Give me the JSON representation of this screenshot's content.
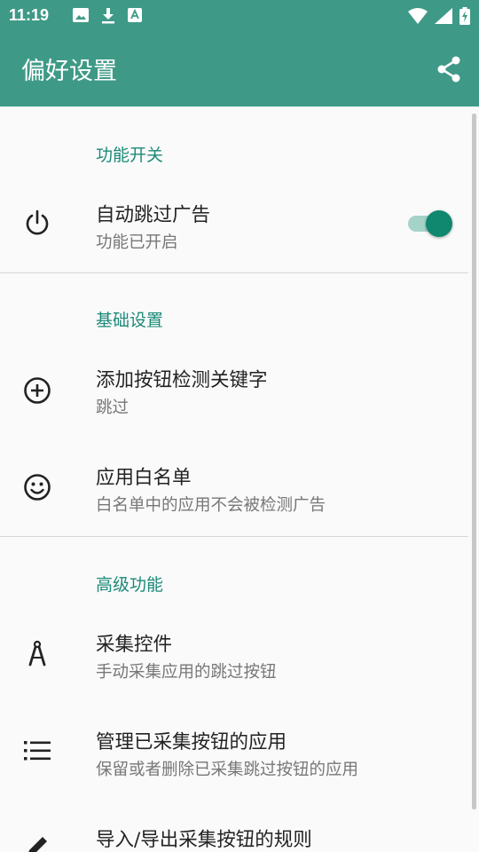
{
  "status_bar": {
    "time": "11:19",
    "left_icons": [
      "image-icon",
      "download-icon",
      "text-icon"
    ],
    "right_icons": [
      "wifi-icon",
      "signal-icon",
      "battery-charging-icon"
    ],
    "color": "#3e9a87"
  },
  "app_bar": {
    "title": "偏好设置",
    "action_icon": "share-icon",
    "color": "#3e9a87"
  },
  "sections": [
    {
      "header": "功能开关",
      "items": [
        {
          "icon": "power-icon",
          "title": "自动跳过广告",
          "summary": "功能已开启",
          "toggle": true
        }
      ]
    },
    {
      "header": "基础设置",
      "items": [
        {
          "icon": "add-circle-icon",
          "title": "添加按钮检测关键字",
          "summary": "跳过"
        },
        {
          "icon": "smiley-icon",
          "title": "应用白名单",
          "summary": "白名单中的应用不会被检测广告"
        }
      ]
    },
    {
      "header": "高级功能",
      "items": [
        {
          "icon": "compass-icon",
          "title": "采集控件",
          "summary": "手动采集应用的跳过按钮"
        },
        {
          "icon": "list-icon",
          "title": "管理已采集按钮的应用",
          "summary": "保留或者删除已采集跳过按钮的应用"
        },
        {
          "icon": "pencil-icon",
          "title": "导入/导出采集按钮的规则",
          "summary": ""
        }
      ]
    }
  ],
  "accent_color": "#1c8a78"
}
